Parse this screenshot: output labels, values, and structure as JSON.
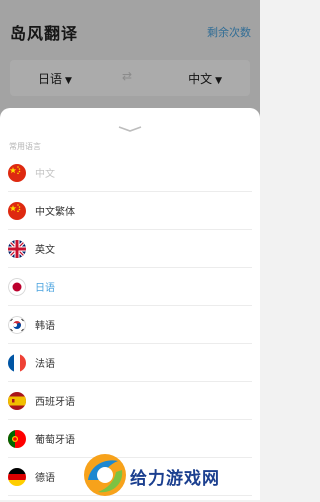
{
  "app": {
    "title": "岛风翻译",
    "remaining_link": "剩余次数",
    "source_lang": "日语",
    "target_lang": "中文",
    "swap_icon": "⇄"
  },
  "sheet": {
    "section_title": "常用语言",
    "languages": [
      {
        "label": "中文",
        "flag": "flag-china-icon",
        "state": "disabled"
      },
      {
        "label": "中文繁体",
        "flag": "flag-china-icon",
        "state": "normal"
      },
      {
        "label": "英文",
        "flag": "flag-uk-icon",
        "state": "normal"
      },
      {
        "label": "日语",
        "flag": "flag-japan-icon",
        "state": "selected"
      },
      {
        "label": "韩语",
        "flag": "flag-korea-icon",
        "state": "normal"
      },
      {
        "label": "法语",
        "flag": "flag-france-icon",
        "state": "normal"
      },
      {
        "label": "西班牙语",
        "flag": "flag-spain-icon",
        "state": "normal"
      },
      {
        "label": "葡萄牙语",
        "flag": "flag-portugal-icon",
        "state": "normal"
      },
      {
        "label": "德语",
        "flag": "flag-germany-icon",
        "state": "normal"
      }
    ]
  },
  "watermark": {
    "text": "给力游戏网"
  },
  "colors": {
    "accent": "#4aa3df",
    "overlay": "rgba(0,0,0,0.33)",
    "selected": "#4aa3df",
    "disabled": "#c4c4c4"
  }
}
